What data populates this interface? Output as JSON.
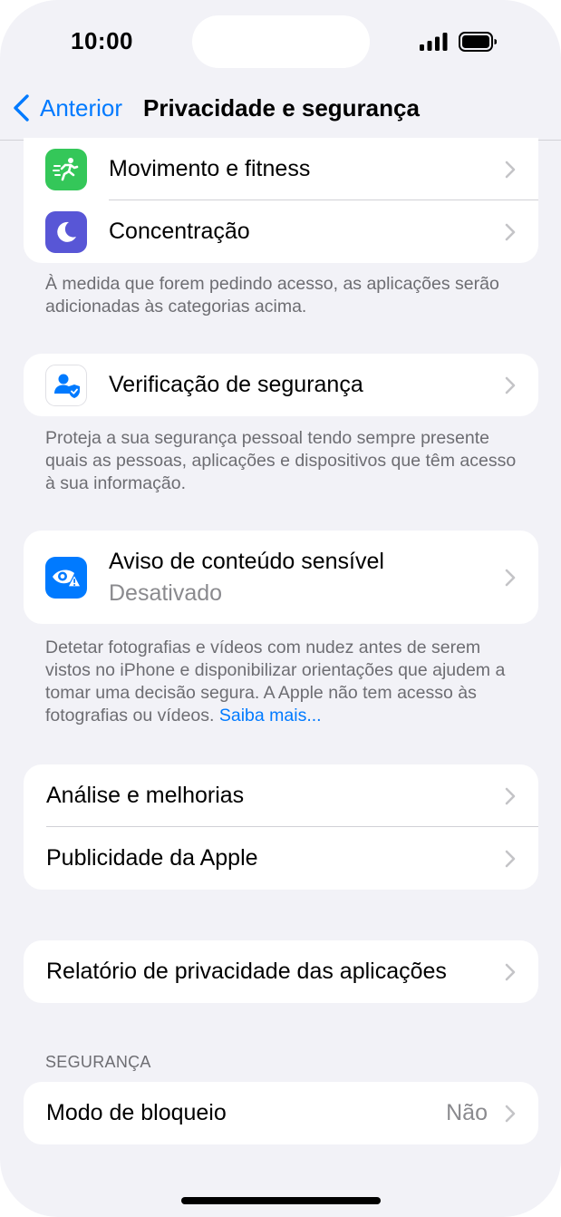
{
  "status_bar": {
    "time": "10:00"
  },
  "nav": {
    "back_label": "Anterior",
    "title": "Privacidade e segurança"
  },
  "group_top": {
    "items": [
      {
        "label": "Movimento e fitness",
        "icon": "fitness-icon",
        "color": "#34c759"
      },
      {
        "label": "Concentração",
        "icon": "moon-icon",
        "color": "#5856d6"
      }
    ],
    "footer": "À medida que forem pedindo acesso, as aplicações serão adicionadas às categorias acima."
  },
  "safety_check": {
    "label": "Verificação de segurança",
    "icon": "safety-check-icon",
    "footer": "Proteja a sua segurança pessoal tendo sempre presente quais as pessoas, aplicações e dispositivos que têm acesso à sua informação."
  },
  "sensitive_content": {
    "label": "Aviso de conteúdo sensível",
    "sublabel": "Desativado",
    "icon": "eye-warning-icon",
    "color": "#007aff",
    "footer": "Detetar fotografias e vídeos com nudez antes de serem vistos no iPhone e disponibilizar orientações que ajudem a tomar uma decisão segura. A Apple não tem acesso às fotografias ou vídeos.",
    "learn_more": "Saiba mais..."
  },
  "analytics_group": {
    "items": [
      {
        "label": "Análise e melhorias"
      },
      {
        "label": "Publicidade da Apple"
      }
    ]
  },
  "app_privacy_report": {
    "label": "Relatório de privacidade das aplicações"
  },
  "security_section": {
    "header": "SEGURANÇA",
    "lockdown": {
      "label": "Modo de bloqueio",
      "value": "Não"
    }
  },
  "colors": {
    "accent": "#007aff",
    "background": "#f2f2f7"
  }
}
